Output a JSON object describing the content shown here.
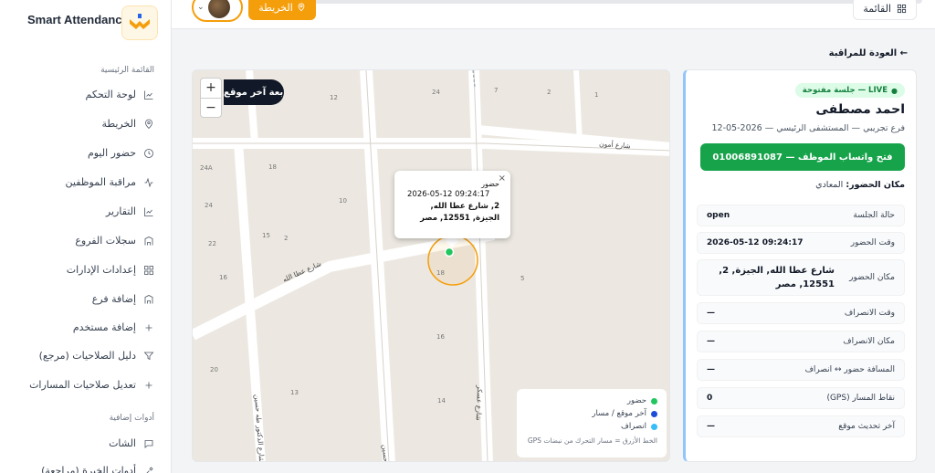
{
  "app": {
    "brand": "Smart Attendance"
  },
  "topbar": {
    "menu_label": "القائمة",
    "map_label": "الخريطة"
  },
  "sidebar": {
    "main_title": "القائمة الرئيسية",
    "items": [
      {
        "label": "لوحة التحكم",
        "icon": "chart-icon"
      },
      {
        "label": "الخريطة",
        "icon": "map-pin-icon"
      },
      {
        "label": "حضور اليوم",
        "icon": "clock-icon"
      },
      {
        "label": "مراقبة الموظفين",
        "icon": "activity-icon"
      },
      {
        "label": "التقارير",
        "icon": "chart-icon"
      },
      {
        "label": "سجلات الفروع",
        "icon": "building-icon"
      },
      {
        "label": "إعدادات الإدارات",
        "icon": "grid-icon"
      },
      {
        "label": "إضافة فرع",
        "icon": "building-icon"
      },
      {
        "label": "إضافة مستخدم",
        "icon": "plus-icon"
      },
      {
        "label": "دليل الصلاحيات (مرجع)",
        "icon": "filter-icon"
      },
      {
        "label": "تعديل صلاحيات المسارات",
        "icon": "plus-icon"
      }
    ],
    "extra_title": "أدوات إضافية",
    "extra_items": [
      {
        "label": "الشات",
        "icon": "chat-icon"
      },
      {
        "label": "أدوات الخبرة (مراجعة)",
        "icon": "tool-icon"
      }
    ]
  },
  "main": {
    "back_label": "← العودة للمراقبة",
    "map": {
      "follow_label": "متابعة آخر موقع",
      "zoom_in": "+",
      "zoom_out": "−",
      "streets": [
        "شارع أمون",
        "شارع عطا الله",
        "شارع الدكتور طه حسين",
        "شارع عسكر",
        "شارع حسين"
      ],
      "block_numbers": [
        "12",
        "24",
        "7",
        "2",
        "1",
        "18",
        "24A",
        "10",
        "24",
        "22",
        "15",
        "2",
        "16",
        "18",
        "5",
        "16",
        "20",
        "13",
        "14"
      ],
      "popup": {
        "close": "×",
        "title": "حضور",
        "time": "2026-05-12 09:24:17",
        "address": "2, شارع عطا الله, الجيزة, 12551, مصر"
      },
      "legend": {
        "items": [
          {
            "label": "حضور",
            "color": "#22c55e"
          },
          {
            "label": "آخر موقع / مسار",
            "color": "#1d4ed8"
          },
          {
            "label": "انصراف",
            "color": "#38bdf8"
          }
        ],
        "note": "الخط الأزرق = مسار التحرك من نبضات GPS"
      }
    },
    "card": {
      "live_badge": "LIVE — جلسة مفتوحة",
      "employee_name": "احمد مصطفى",
      "subtitle": "فرع تجريبي — المستشفى الرئيسي — 2026-05-12",
      "whatsapp_label": "فتح واتساب الموظف — 01006891087",
      "place_label": "مكان الحضور:",
      "place_value": "المعادي",
      "rows": [
        {
          "key": "حالة الجلسة",
          "value": "open"
        },
        {
          "key": "وقت الحضور",
          "value": "2026-05-12 09:24:17"
        },
        {
          "key": "مكان الحضور",
          "value": "شارع عطا الله, الجيزة, 2, 12551, مصر"
        },
        {
          "key": "وقت الانصراف",
          "value": "—"
        },
        {
          "key": "مكان الانصراف",
          "value": "—"
        },
        {
          "key": "المسافة حضور ↔ انصراف",
          "value": "—"
        },
        {
          "key": "نقاط المسار (GPS)",
          "value": "0"
        },
        {
          "key": "آخر تحديث موقع",
          "value": "—"
        }
      ]
    }
  },
  "colors": {
    "accent": "#f59e0b",
    "success": "#16a34a",
    "dark": "#111827"
  }
}
